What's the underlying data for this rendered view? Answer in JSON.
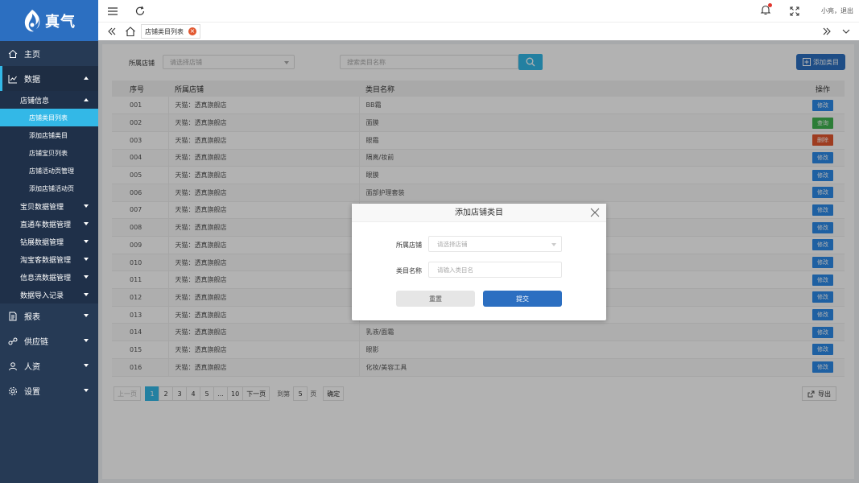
{
  "brand": {
    "name": "真气",
    "color": "#2c6fc1"
  },
  "header": {
    "user": "小亮",
    "separator": "，",
    "logout": "退出"
  },
  "sidebar": {
    "items": [
      {
        "label": "主页",
        "icon": "home-icon"
      },
      {
        "label": "数据",
        "icon": "chart-line-icon"
      },
      {
        "label": "报表",
        "icon": "report-icon"
      },
      {
        "label": "供应链",
        "icon": "supply-chain-icon"
      },
      {
        "label": "人资",
        "icon": "people-icon"
      },
      {
        "label": "设置",
        "icon": "gear-icon"
      }
    ],
    "data_group": {
      "store_info": "店铺信息",
      "store_leaves": [
        "店铺类目列表",
        "添加店铺类目",
        "店铺宝贝列表",
        "店铺活动页管理",
        "添加店铺活动页"
      ],
      "subgroups": [
        "宝贝数据管理",
        "直通车数据管理",
        "钻展数据管理",
        "淘宝客数据管理",
        "信息流数据管理",
        "数据导入记录"
      ]
    }
  },
  "tabs": {
    "active": "店铺类目列表"
  },
  "filters": {
    "store_label": "所属店铺",
    "store_placeholder": "请选择店铺",
    "search_placeholder": "搜索类目名称",
    "add_button": "添加类目"
  },
  "table": {
    "headers": [
      "序号",
      "所属店铺",
      "类目名称",
      "操作"
    ],
    "rows": [
      {
        "no": "001",
        "store": "天猫：透真旗舰店",
        "category": "BB霜",
        "action": "修改",
        "kind": "edit"
      },
      {
        "no": "002",
        "store": "天猫：透真旗舰店",
        "category": "面膜",
        "action": "查询",
        "kind": "query"
      },
      {
        "no": "003",
        "store": "天猫：透真旗舰店",
        "category": "眼霜",
        "action": "删除",
        "kind": "delete"
      },
      {
        "no": "004",
        "store": "天猫：透真旗舰店",
        "category": "隔离/妆前",
        "action": "修改",
        "kind": "edit"
      },
      {
        "no": "005",
        "store": "天猫：透真旗舰店",
        "category": "眼膜",
        "action": "修改",
        "kind": "edit"
      },
      {
        "no": "006",
        "store": "天猫：透真旗舰店",
        "category": "面部护理套装",
        "action": "修改",
        "kind": "edit"
      },
      {
        "no": "007",
        "store": "天猫：透真旗舰店",
        "category": "",
        "action": "修改",
        "kind": "edit"
      },
      {
        "no": "008",
        "store": "天猫：透真旗舰店",
        "category": "",
        "action": "修改",
        "kind": "edit"
      },
      {
        "no": "009",
        "store": "天猫：透真旗舰店",
        "category": "",
        "action": "修改",
        "kind": "edit"
      },
      {
        "no": "010",
        "store": "天猫：透真旗舰店",
        "category": "",
        "action": "修改",
        "kind": "edit"
      },
      {
        "no": "011",
        "store": "天猫：透真旗舰店",
        "category": "",
        "action": "修改",
        "kind": "edit"
      },
      {
        "no": "012",
        "store": "天猫：透真旗舰店",
        "category": "",
        "action": "修改",
        "kind": "edit"
      },
      {
        "no": "013",
        "store": "天猫：透真旗舰店",
        "category": "",
        "action": "修改",
        "kind": "edit"
      },
      {
        "no": "014",
        "store": "天猫：透真旗舰店",
        "category": "乳液/面霜",
        "action": "修改",
        "kind": "edit"
      },
      {
        "no": "015",
        "store": "天猫：透真旗舰店",
        "category": "眼影",
        "action": "修改",
        "kind": "edit"
      },
      {
        "no": "016",
        "store": "天猫：透真旗舰店",
        "category": "化妆/美容工具",
        "action": "修改",
        "kind": "edit"
      }
    ],
    "action_colors": {
      "edit": "#2c8ae8",
      "query": "#3fb34f",
      "delete": "#e2572f"
    }
  },
  "pagination": {
    "prev": "上一页",
    "pages": [
      "1",
      "2",
      "3",
      "4",
      "5",
      "...",
      "10"
    ],
    "current": "1",
    "next": "下一页",
    "goto_label": "到第",
    "goto_value": "5",
    "page_unit": "页",
    "confirm": "确定"
  },
  "export_button": "导出",
  "modal": {
    "title": "添加店铺类目",
    "store_label": "所属店铺",
    "store_placeholder": "请选择店铺",
    "name_label": "类目名称",
    "name_placeholder": "请输入类目名",
    "reset": "重置",
    "submit": "提交"
  },
  "colors": {
    "sidebar": "#263a55",
    "accent": "#33b8e7",
    "primary": "#2c6fc1"
  }
}
